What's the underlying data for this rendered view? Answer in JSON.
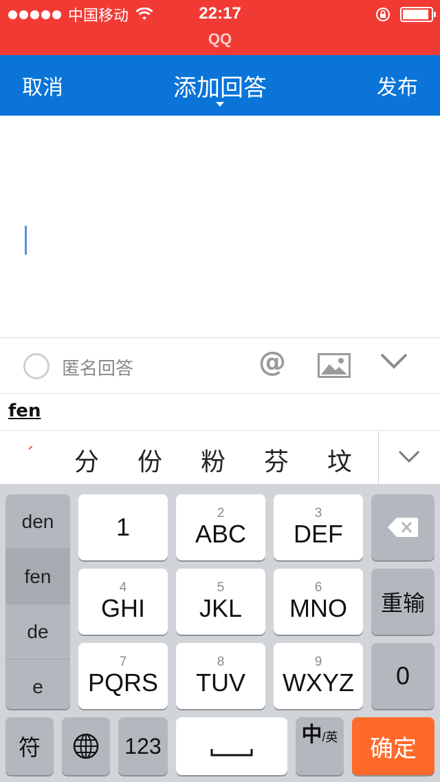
{
  "status_bar": {
    "carrier": "中国移动",
    "time": "22:17",
    "app_name": "QQ",
    "signal_bars": 5,
    "battery_level": 0.85
  },
  "nav": {
    "cancel_label": "取消",
    "title": "添加回答",
    "publish_label": "发布"
  },
  "editor": {
    "text": ""
  },
  "toolbar": {
    "anonymous_label": "匿名回答",
    "anonymous_checked": false,
    "icons": [
      "at-icon",
      "image-icon",
      "collapse-keyboard-icon"
    ]
  },
  "ime": {
    "composition": "fen",
    "candidates": [
      "ˊ",
      "分",
      "份",
      "粉",
      "芬",
      "坟"
    ],
    "pinyin_options": [
      "den",
      "fen",
      "de",
      "e"
    ],
    "selected_pinyin": "fen",
    "keys": {
      "row1": [
        {
          "num": "",
          "letters": "1"
        },
        {
          "num": "2",
          "letters": "ABC"
        },
        {
          "num": "3",
          "letters": "DEF"
        }
      ],
      "row2": [
        {
          "num": "4",
          "letters": "GHI"
        },
        {
          "num": "5",
          "letters": "JKL"
        },
        {
          "num": "6",
          "letters": "MNO"
        }
      ],
      "row3": [
        {
          "num": "7",
          "letters": "PQRS"
        },
        {
          "num": "8",
          "letters": "TUV"
        },
        {
          "num": "9",
          "letters": "WXYZ"
        }
      ],
      "reinput_label": "重输",
      "zero_label": "0",
      "symbol_label": "符",
      "num_mode_label": "123",
      "lang_label_main": "中",
      "lang_label_sub": "/英",
      "confirm_label": "确定"
    }
  },
  "colors": {
    "status_bar": "#f23a34",
    "nav_bar": "#0a74d8",
    "confirm_key": "#ff6a2a"
  }
}
